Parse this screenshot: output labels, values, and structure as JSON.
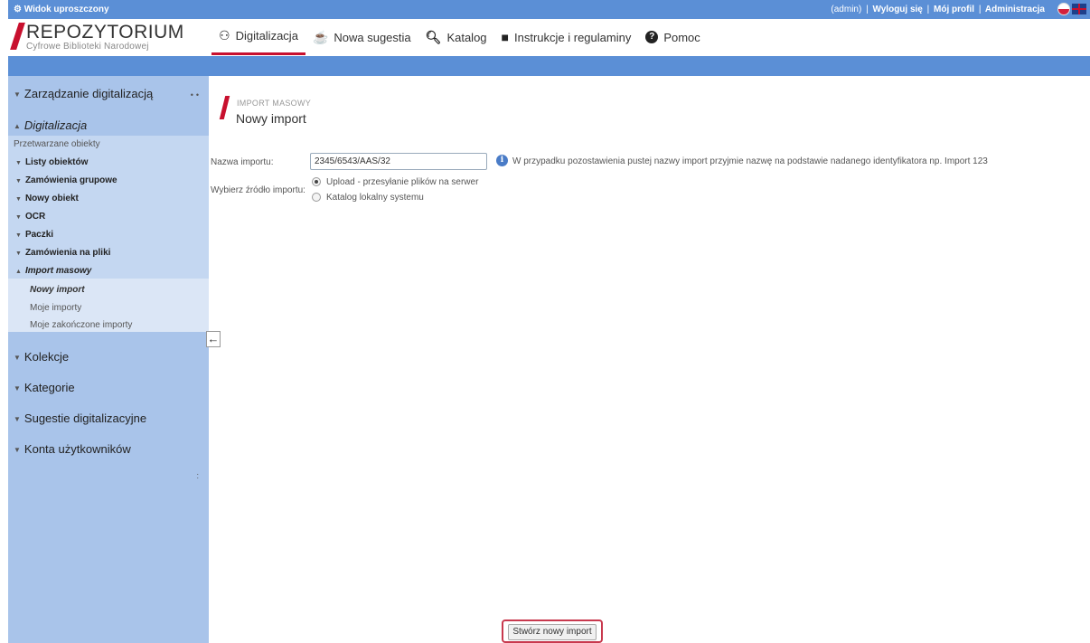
{
  "topbar": {
    "view_mode": "Widok uproszczony",
    "user": "(admin)",
    "sep": "|",
    "logout": "Wyloguj się",
    "profile": "Mój profil",
    "admin": "Administracja"
  },
  "logo": {
    "title": "REPOZYTORIUM",
    "subtitle": "Cyfrowe Biblioteki Narodowej"
  },
  "nav": {
    "items": [
      {
        "label": "Digitalizacja",
        "icon": "binoculars-icon"
      },
      {
        "label": "Nowa sugestia",
        "icon": "lightbulb-icon"
      },
      {
        "label": "Katalog",
        "icon": "search-icon"
      },
      {
        "label": "Instrukcje i regulaminy",
        "icon": "book-icon"
      },
      {
        "label": "Pomoc",
        "icon": "question-icon"
      }
    ]
  },
  "sidebar": {
    "sections": [
      "Zarządzanie digitalizacją",
      "Digitalizacja",
      "Kolekcje",
      "Kategorie",
      "Sugestie digitalizacyjne",
      "Konta użytkowników"
    ],
    "group_label": "Przetwarzane obiekty",
    "items": [
      "Listy obiektów",
      "Zamówienia grupowe",
      "Nowy obiekt",
      "OCR",
      "Paczki",
      "Zamówienia na pliki",
      "Import masowy"
    ],
    "sub_items": [
      "Nowy import",
      "Moje importy",
      "Moje zakończone importy"
    ]
  },
  "main": {
    "breadcrumb": "IMPORT MASOWY",
    "title": "Nowy import",
    "name_label": "Nazwa importu:",
    "name_value": "2345/6543/AAS/32",
    "info_text": "W przypadku pozostawienia pustej nazwy import przyjmie nazwę na podstawie nadanego identyfikatora np. Import 123",
    "source_label": "Wybierz źródło importu:",
    "source_options": [
      "Upload - przesyłanie plików na serwer",
      "Katalog lokalny systemu"
    ],
    "source_selected": 0,
    "submit_label": "Stwórz nowy import"
  },
  "colors": {
    "accent": "#c8102e",
    "bar_blue": "#5b8fd6",
    "sidebar_bg": "#a9c4ea"
  }
}
